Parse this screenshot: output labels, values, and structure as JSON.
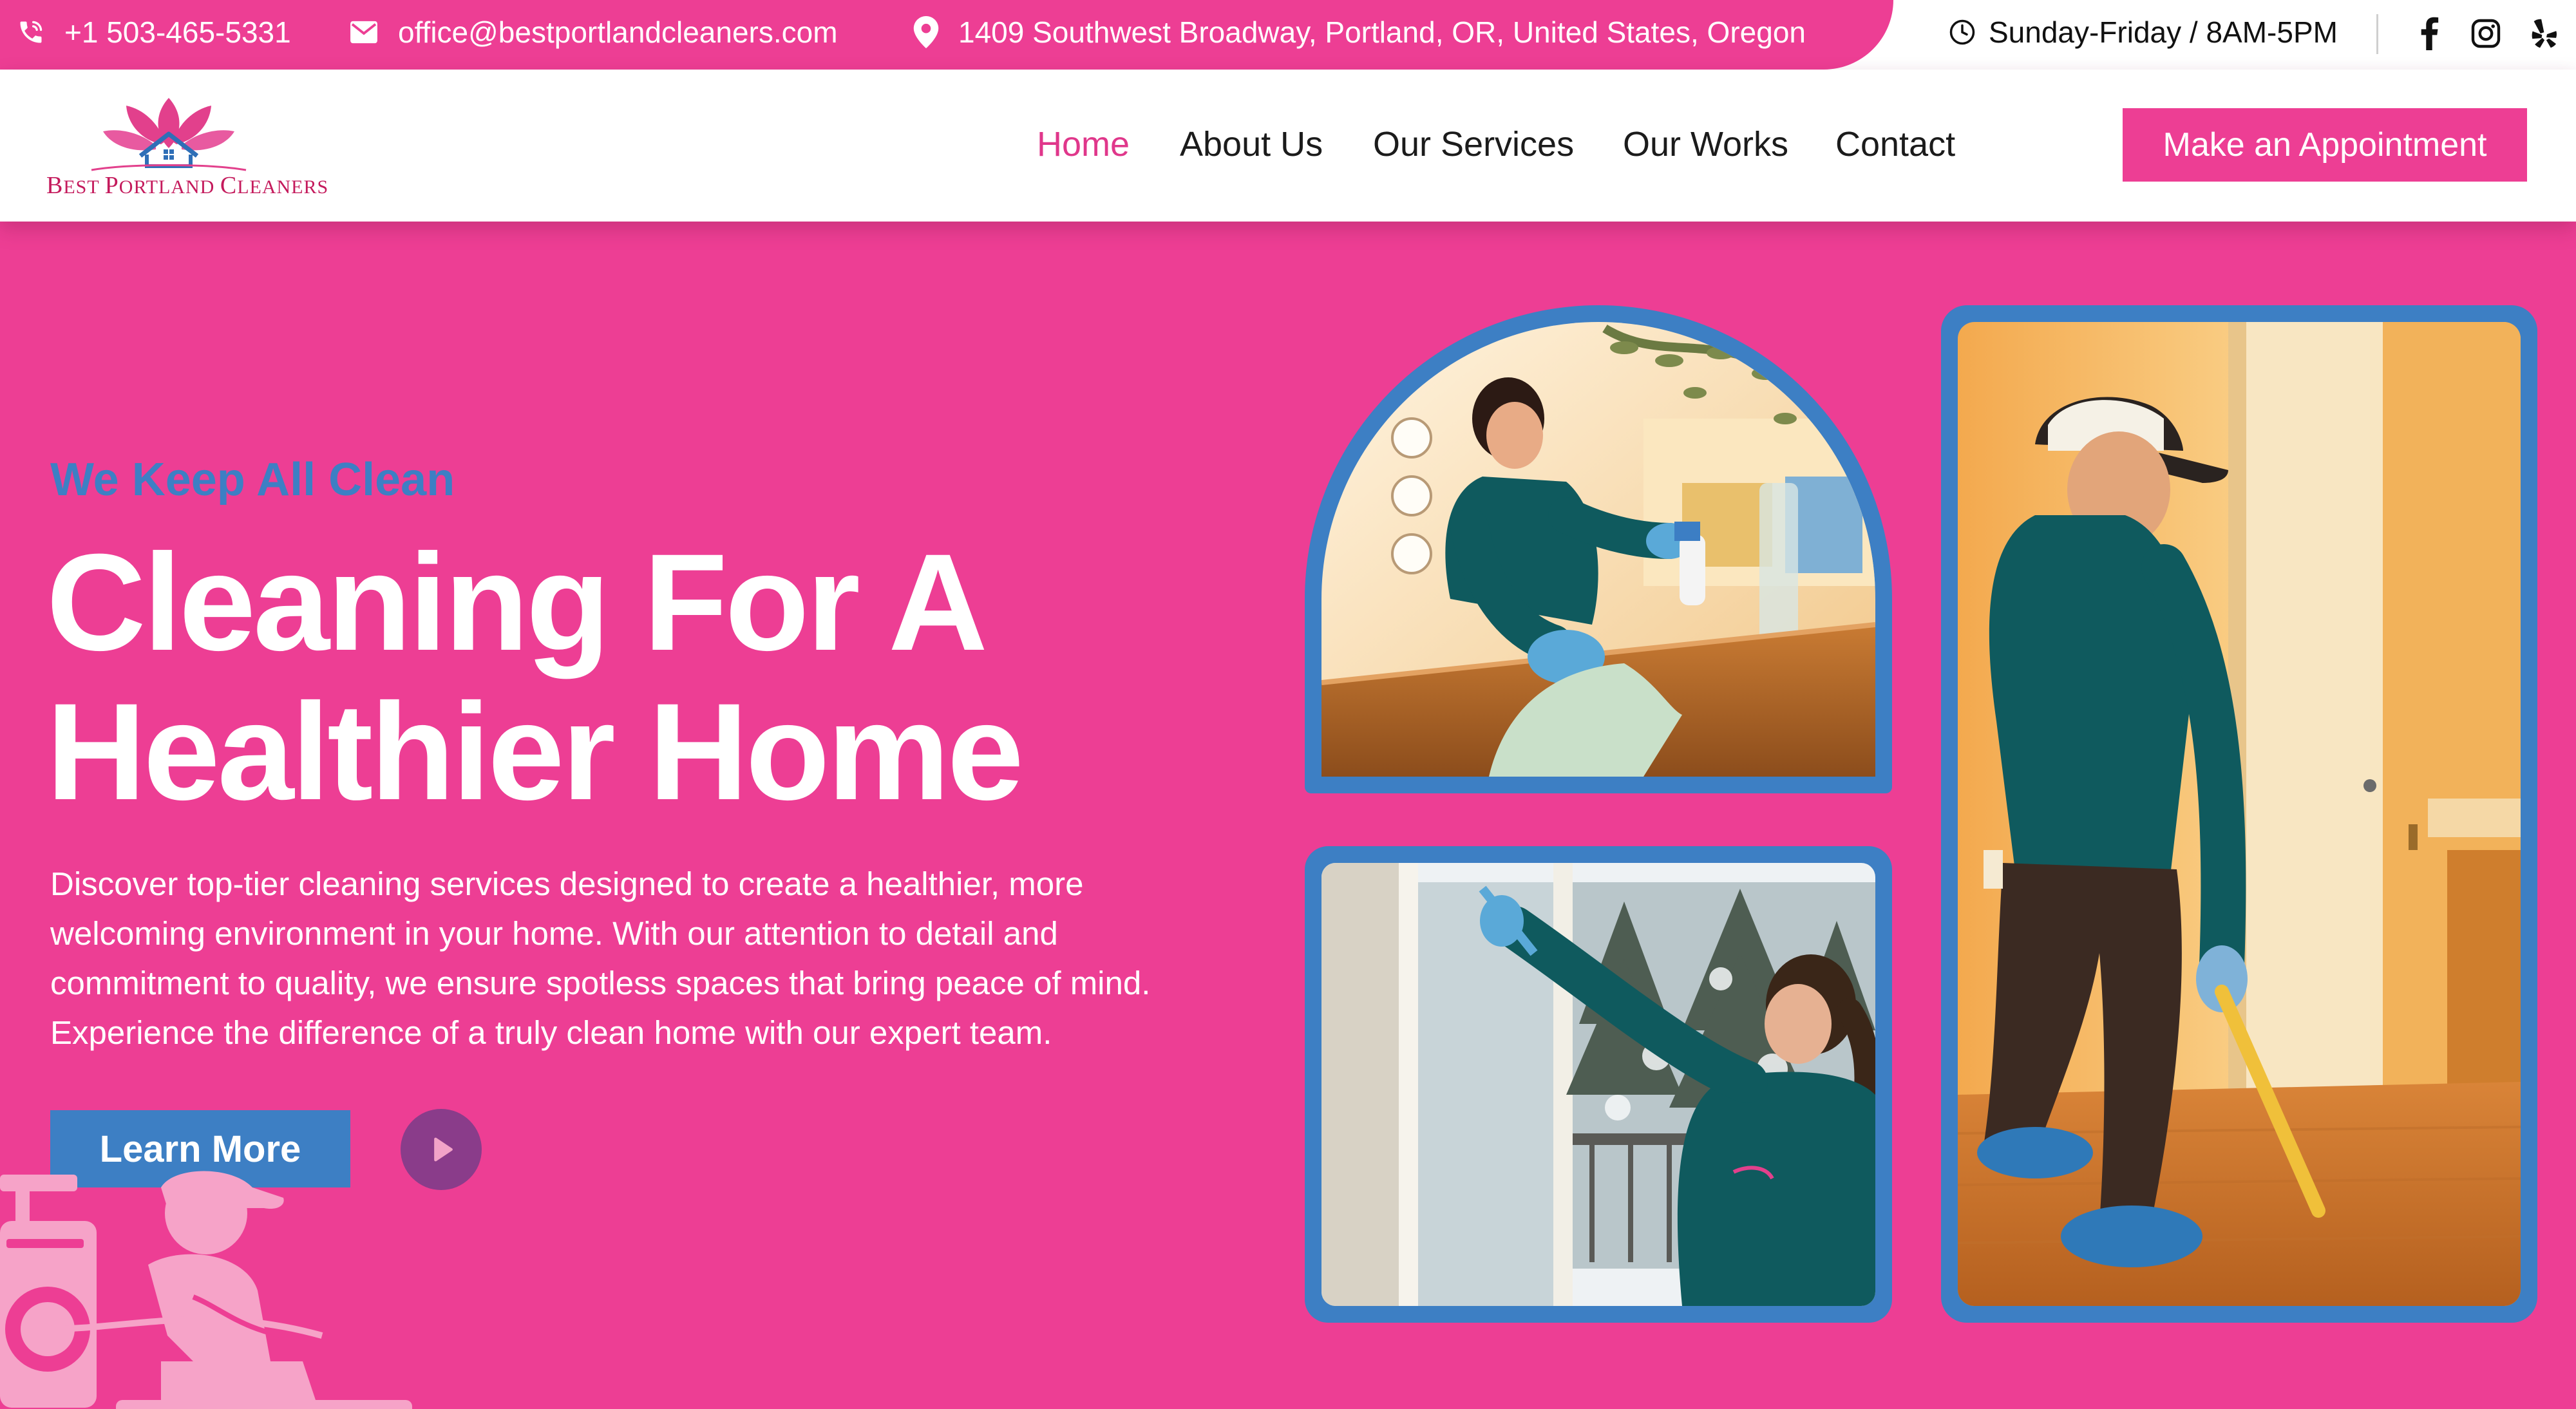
{
  "topbar": {
    "phone": "+1 503-465-5331",
    "email": "office@bestportlandcleaners.com",
    "address": "1409 Southwest Broadway, Portland, OR, United States, Oregon",
    "hours": "Sunday-Friday / 8AM-5PM",
    "social_icons": [
      "facebook-icon",
      "instagram-icon",
      "yelp-icon"
    ]
  },
  "brand": {
    "logo_text": "Best Portland Cleaners",
    "logo_line_first": "B",
    "logo_line_rest1": "EST ",
    "logo_line_p": "P",
    "logo_line_rest2": "ORTLAND ",
    "logo_line_c": "C",
    "logo_line_rest3": "LEANERS"
  },
  "nav": {
    "items": [
      {
        "label": "Home",
        "active": true
      },
      {
        "label": "About Us",
        "active": false
      },
      {
        "label": "Our Services",
        "active": false
      },
      {
        "label": "Our Works",
        "active": false
      },
      {
        "label": "Contact",
        "active": false
      }
    ],
    "cta_label": "Make an Appointment"
  },
  "hero": {
    "eyebrow": "We Keep All Clean",
    "headline_lines": [
      "Cleaning For A",
      "Healthier Home"
    ],
    "description_lines": [
      "Discover top-tier cleaning services designed to create a healthier, more",
      "welcoming environment in your home. With our attention to detail and",
      "commitment to quality, we ensure spotless spaces that bring peace of mind.",
      "Experience the difference of a truly clean home with our expert team."
    ],
    "learn_more_label": "Learn More"
  },
  "colors": {
    "brand_pink": "#ed3e94",
    "accent_blue": "#3d7fc4",
    "nav_active": "#e0378b",
    "play_purple": "#8a3c8a",
    "uniform_teal": "#0f5a5e"
  }
}
